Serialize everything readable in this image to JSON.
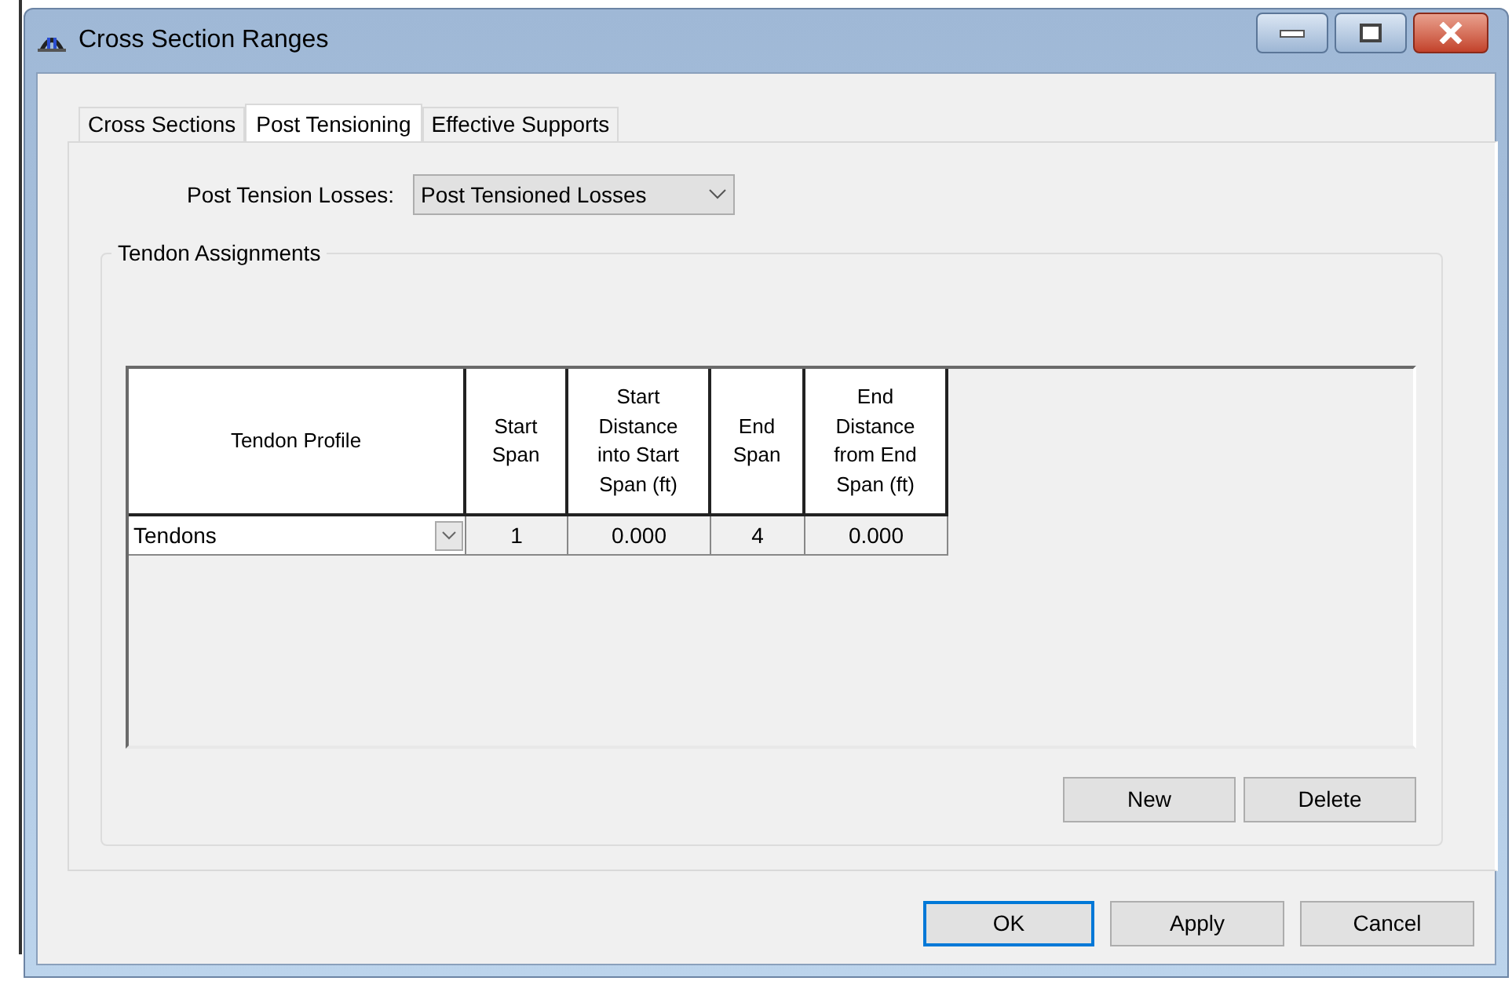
{
  "window": {
    "title": "Cross Section Ranges"
  },
  "tabs": [
    {
      "label": "Cross Sections",
      "selected": false
    },
    {
      "label": "Post Tensioning",
      "selected": true
    },
    {
      "label": "Effective Supports",
      "selected": false
    }
  ],
  "losses": {
    "label": "Post Tension Losses:",
    "value": "Post Tensioned Losses"
  },
  "group": {
    "title": "Tendon Assignments"
  },
  "table": {
    "columns": [
      {
        "label": "Tendon Profile"
      },
      {
        "label": "Start Span"
      },
      {
        "label": "Start Distance into Start Span (ft)"
      },
      {
        "label": "End Span"
      },
      {
        "label": "End Distance from End Span (ft)"
      }
    ],
    "rows": [
      {
        "profile": "Tendons",
        "start_span": "1",
        "start_distance": "0.000",
        "end_span": "4",
        "end_distance": "0.000"
      }
    ]
  },
  "group_buttons": [
    "New",
    "Delete"
  ],
  "buttons": [
    {
      "label": "OK",
      "default": true
    },
    {
      "label": "Apply",
      "default": false
    },
    {
      "label": "Cancel",
      "default": false
    }
  ]
}
